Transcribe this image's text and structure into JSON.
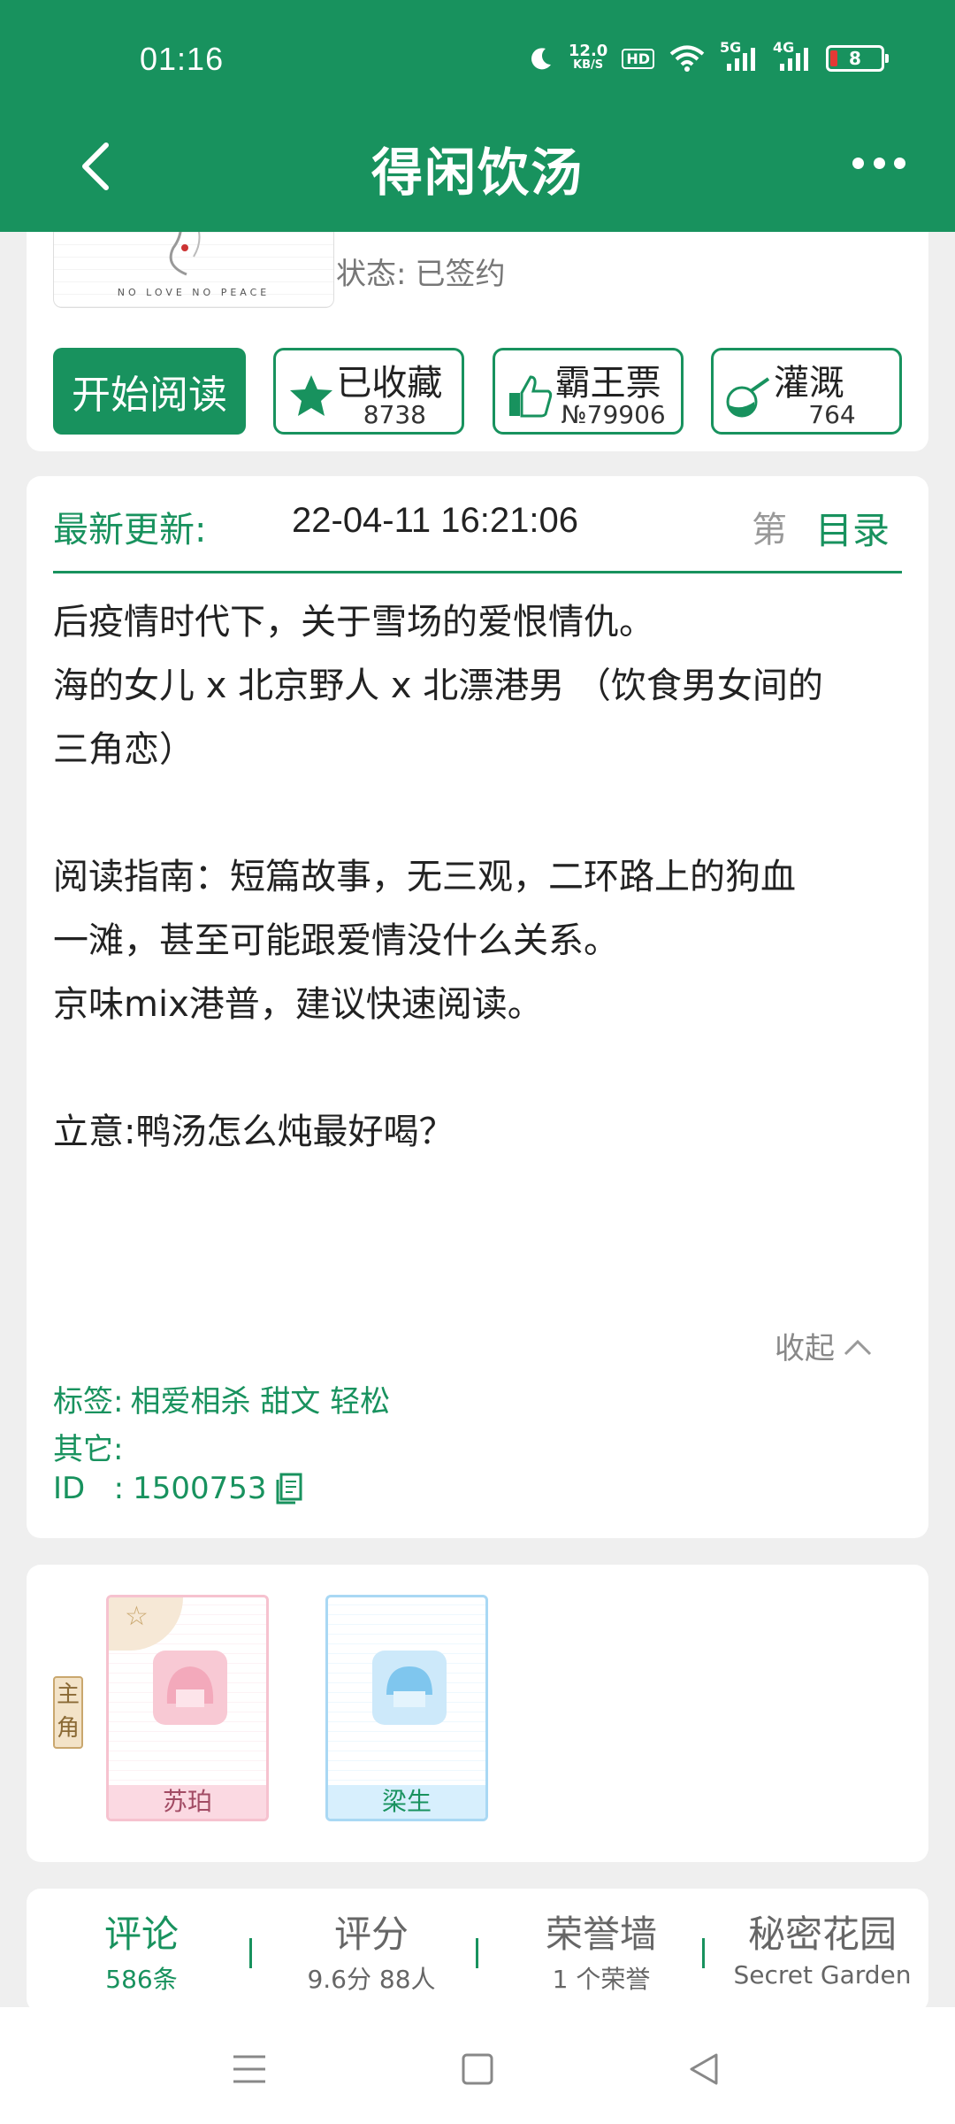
{
  "status_bar": {
    "time": "01:16",
    "net_speed_value": "12.0",
    "net_speed_unit": "KB/S",
    "hd_label": "HD",
    "signal_5g": "5G",
    "signal_4g": "4G",
    "battery_level": "8"
  },
  "header": {
    "title": "得闲饮汤",
    "back_icon": "chevron-left-icon",
    "more_icon": "more-dots-icon"
  },
  "book": {
    "cover_tagline": "NO LOVE NO PEACE",
    "status_label": "状态:",
    "status_value": "已签约"
  },
  "actions": {
    "read_label": "开始阅读",
    "favorite_label": "已收藏",
    "favorite_count": "8738",
    "ticket_label": "霸王票",
    "ticket_rank": "№79906",
    "water_label": "灌溉",
    "water_count": "764"
  },
  "update": {
    "label": "最新更新:",
    "time": "22-04-11 16:21:06",
    "chapter_fragment": "第",
    "toc_label": "目录"
  },
  "summary": {
    "line1": "后疫情时代下，关于雪场的爱恨情仇。",
    "line2": "海的女儿 x 北京野人 x 北漂港男 （饮食男女间的",
    "line3": "三角恋）",
    "line4": "阅读指南：短篇故事，无三观，二环路上的狗血",
    "line5": "一滩，甚至可能跟爱情没什么关系。",
    "line6": "京味mix港普，建议快速阅读。",
    "line7": "立意:鸭汤怎么炖最好喝？",
    "collapse_label": "收起"
  },
  "meta": {
    "tags_label": "标签:",
    "tags_value": "相爱相杀 甜文 轻松",
    "other_label": "其它:",
    "id_label": "ID   :",
    "id_value": "1500753"
  },
  "characters": {
    "role_label": "主角",
    "items": [
      {
        "name": "苏珀"
      },
      {
        "name": "梁生"
      }
    ]
  },
  "tabs": [
    {
      "title": "评论",
      "sub": "586条"
    },
    {
      "title": "评分",
      "sub": "9.6分 88人"
    },
    {
      "title": "荣誉墙",
      "sub": "1 个荣誉"
    },
    {
      "title": "秘密花园",
      "sub": "Secret Garden"
    }
  ],
  "colors": {
    "brand_green": "#18925e",
    "battery_low": "#e53935"
  }
}
